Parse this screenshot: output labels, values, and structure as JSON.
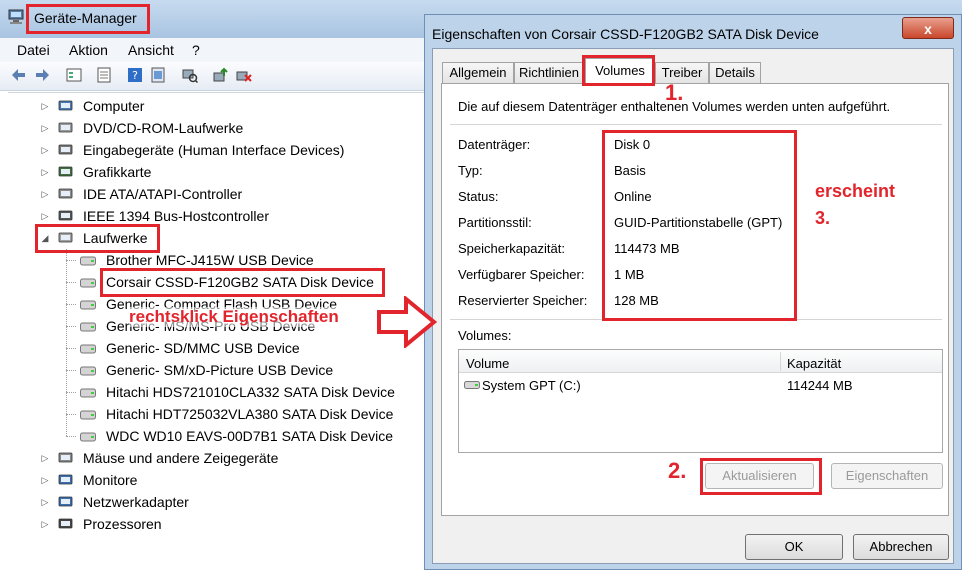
{
  "device_manager": {
    "title": "Geräte-Manager",
    "menu": [
      "Datei",
      "Aktion",
      "Ansicht",
      "?"
    ],
    "tree": [
      {
        "label": "Computer",
        "icon": "computer-icon",
        "expanded": false
      },
      {
        "label": "DVD/CD-ROM-Laufwerke",
        "icon": "dvd-drive-icon",
        "expanded": false
      },
      {
        "label": "Eingabegeräte (Human Interface Devices)",
        "icon": "hid-icon",
        "expanded": false
      },
      {
        "label": "Grafikkarte",
        "icon": "graphics-card-icon",
        "expanded": false
      },
      {
        "label": "IDE ATA/ATAPI-Controller",
        "icon": "ide-controller-icon",
        "expanded": false
      },
      {
        "label": "IEEE 1394 Bus-Hostcontroller",
        "icon": "ieee1394-icon",
        "expanded": false
      },
      {
        "label": "Laufwerke",
        "icon": "drive-icon",
        "expanded": true,
        "children": [
          "Brother MFC-J415W USB Device",
          "Corsair CSSD-F120GB2 SATA Disk Device",
          "Generic- Compact Flash USB Device",
          "Generic- MS/MS-Pro USB Device",
          "Generic- SD/MMC USB Device",
          "Generic- SM/xD-Picture USB Device",
          "Hitachi HDS721010CLA332 SATA Disk Device",
          "Hitachi HDT725032VLA380 SATA Disk Device",
          "WDC WD10 EAVS-00D7B1 SATA Disk Device"
        ]
      },
      {
        "label": "Mäuse und andere Zeigegeräte",
        "icon": "mouse-icon",
        "expanded": false
      },
      {
        "label": "Monitore",
        "icon": "monitor-icon",
        "expanded": false
      },
      {
        "label": "Netzwerkadapter",
        "icon": "network-adapter-icon",
        "expanded": false
      },
      {
        "label": "Prozessoren",
        "icon": "processor-icon",
        "expanded": false
      }
    ]
  },
  "dialog": {
    "title": "Eigenschaften von Corsair CSSD-F120GB2 SATA Disk Device",
    "close_label": "x",
    "tabs": [
      "Allgemein",
      "Richtlinien",
      "Volumes",
      "Treiber",
      "Details"
    ],
    "active_tab": "Volumes",
    "description": "Die auf diesem Datenträger enthaltenen Volumes werden unten aufgeführt.",
    "properties": [
      {
        "label": "Datenträger:",
        "value": "Disk 0"
      },
      {
        "label": "Typ:",
        "value": "Basis"
      },
      {
        "label": "Status:",
        "value": "Online"
      },
      {
        "label": "Partitionsstil:",
        "value": "GUID-Partitionstabelle (GPT)"
      },
      {
        "label": "Speicherkapazität:",
        "value": "114473 MB"
      },
      {
        "label": "Verfügbarer Speicher:",
        "value": "1 MB"
      },
      {
        "label": "Reservierter Speicher:",
        "value": "128 MB"
      }
    ],
    "volumes_label": "Volumes:",
    "volume_columns": [
      "Volume",
      "Kapazität"
    ],
    "volumes": [
      {
        "name": "System GPT (C:)",
        "capacity": "114244 MB"
      }
    ],
    "buttons": {
      "update": "Aktualisieren",
      "properties": "Eigenschaften",
      "ok": "OK",
      "cancel": "Abbrechen"
    }
  },
  "annotations": {
    "step1": "1.",
    "step2": "2.",
    "step3_line1": "erscheint",
    "step3_line2": "3.",
    "right_click_hint": "rechtsklick Eigenschaften",
    "color": "#e2252c"
  }
}
